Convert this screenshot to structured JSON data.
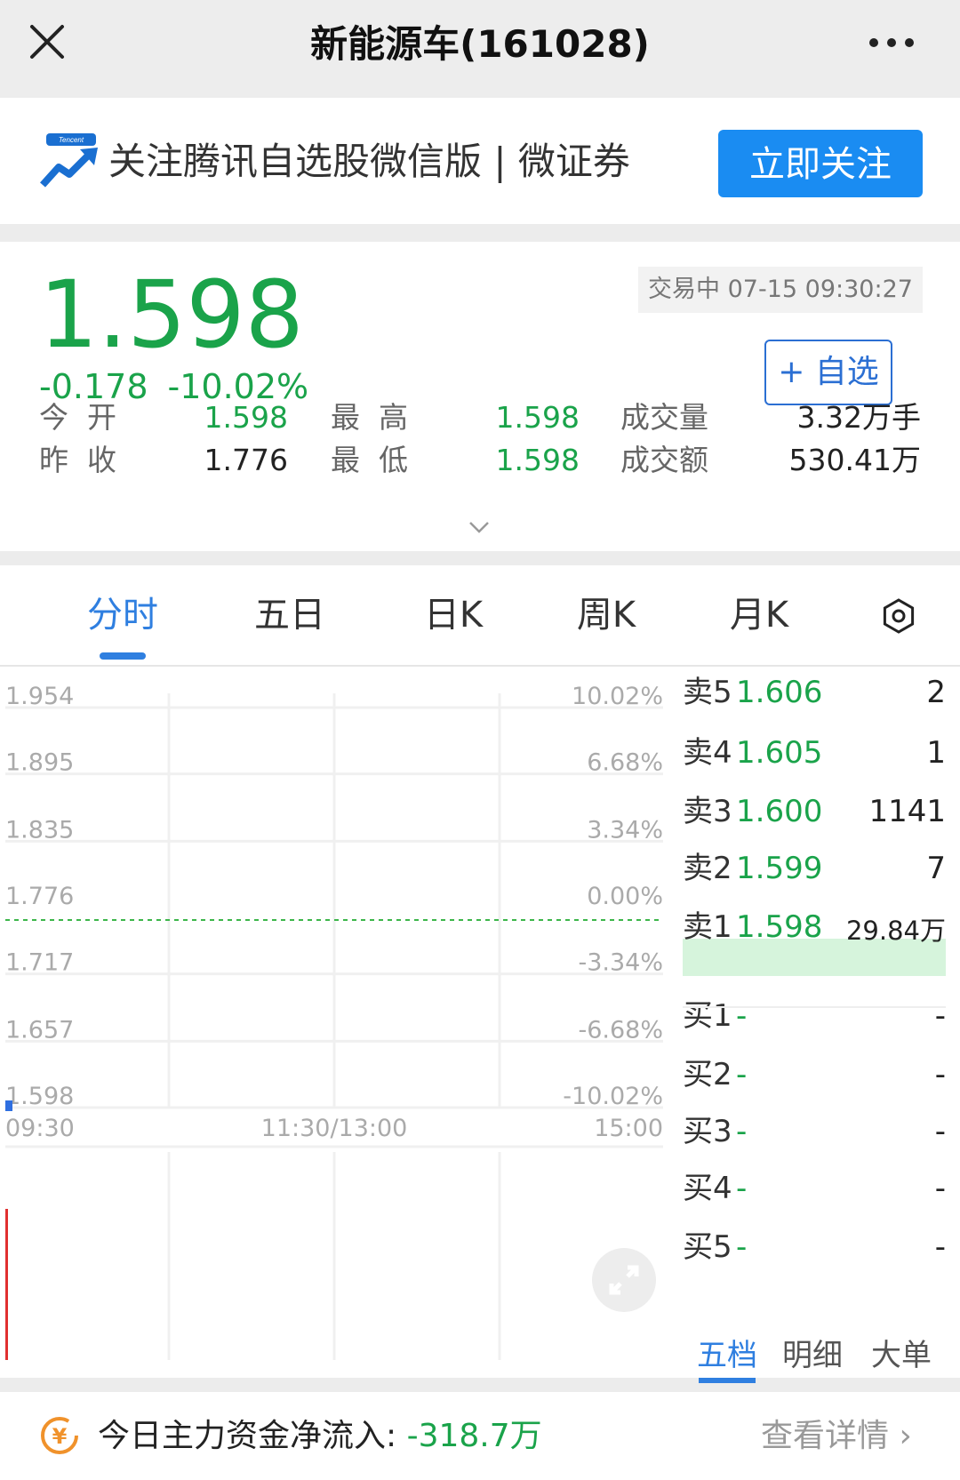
{
  "header": {
    "title": "新能源车(161028)"
  },
  "banner": {
    "text": "关注腾讯自选股微信版 | 微证券",
    "logo_text": "Tencent",
    "follow_button": "立即关注"
  },
  "quote": {
    "price": "1.598",
    "change": "-0.178",
    "change_pct": "-10.02%",
    "status": "交易中 07-15 09:30:27",
    "watch_button": "+ 自选",
    "stats": {
      "open_label": "今  开",
      "open": "1.598",
      "high_label": "最  高",
      "high": "1.598",
      "volume_label": "成交量",
      "volume": "3.32万手",
      "prev_close_label": "昨  收",
      "prev_close": "1.776",
      "low_label": "最  低",
      "low": "1.598",
      "amount_label": "成交额",
      "amount": "530.41万"
    },
    "colors": {
      "down": "#1aa34a",
      "accent": "#2f7fe0"
    }
  },
  "tabs": [
    {
      "label": "分时",
      "active": true
    },
    {
      "label": "五日"
    },
    {
      "label": "日K"
    },
    {
      "label": "周K"
    },
    {
      "label": "月K"
    }
  ],
  "chart_data": {
    "type": "line",
    "y_ticks": [
      "1.954",
      "1.895",
      "1.835",
      "1.776",
      "1.717",
      "1.657",
      "1.598"
    ],
    "y_values": [
      1.954,
      1.895,
      1.835,
      1.776,
      1.717,
      1.657,
      1.598
    ],
    "pct_ticks": [
      "10.02%",
      "6.68%",
      "3.34%",
      "0.00%",
      "-3.34%",
      "-6.68%",
      "-10.02%"
    ],
    "x_ticks": [
      "09:30",
      "11:30/13:00",
      "15:00"
    ],
    "reference_price": 1.776,
    "ylim": [
      1.598,
      1.954
    ],
    "series": [
      {
        "x": [
          "09:30"
        ],
        "values": [
          1.598
        ]
      }
    ],
    "volume": {
      "x": [
        "09:30"
      ],
      "values": [
        33200
      ]
    }
  },
  "order_book": {
    "asks": [
      {
        "label": "卖5",
        "price": "1.606",
        "volume": "2"
      },
      {
        "label": "卖4",
        "price": "1.605",
        "volume": "1"
      },
      {
        "label": "卖3",
        "price": "1.600",
        "volume": "1141"
      },
      {
        "label": "卖2",
        "price": "1.599",
        "volume": "7"
      },
      {
        "label": "卖1",
        "price": "1.598",
        "volume": "29.84万"
      }
    ],
    "bids": [
      {
        "label": "买1",
        "price": "-",
        "volume": "-"
      },
      {
        "label": "买2",
        "price": "-",
        "volume": "-"
      },
      {
        "label": "买3",
        "price": "-",
        "volume": "-"
      },
      {
        "label": "买4",
        "price": "-",
        "volume": "-"
      },
      {
        "label": "买5",
        "price": "-",
        "volume": "-"
      }
    ],
    "tabs": [
      "五档",
      "明细",
      "大单"
    ]
  },
  "bottom": {
    "flow_label": "今日主力资金净流入: ",
    "flow_value": "-318.7万",
    "detail_link": "查看详情"
  }
}
